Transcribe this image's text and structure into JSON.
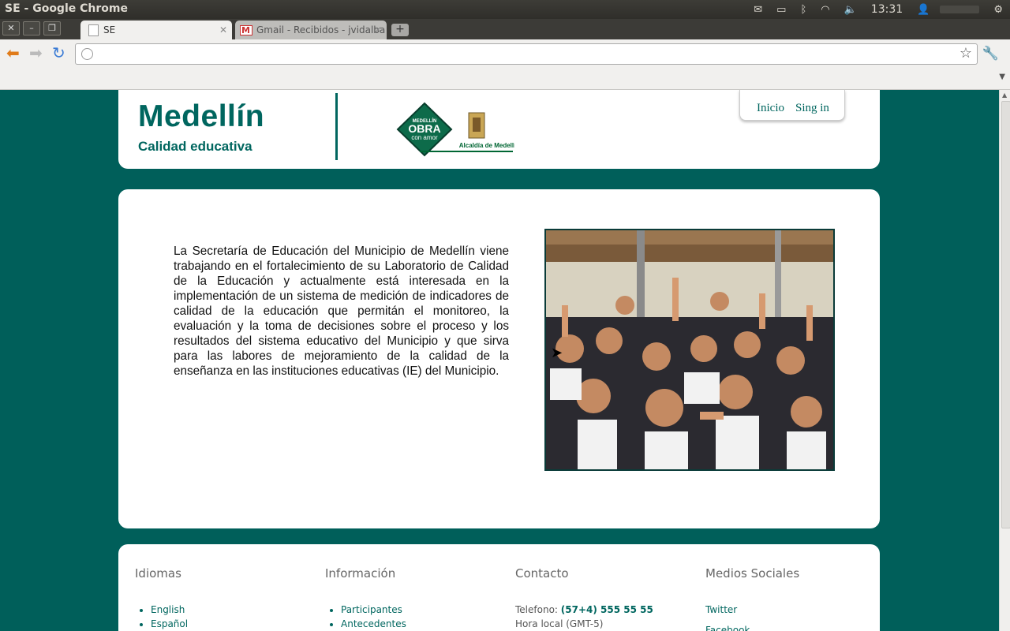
{
  "system": {
    "window_title": "SE - Google Chrome",
    "clock": "13:31"
  },
  "browser": {
    "tabs": [
      {
        "label": "SE",
        "active": true
      },
      {
        "label": "Gmail - Recibidos - jvidalba",
        "active": false
      }
    ],
    "address": ""
  },
  "header": {
    "brand_title": "Medellín",
    "brand_subtitle": "Calidad educativa",
    "logo_text": {
      "line1": "MEDELLÍN",
      "line2": "OBRA",
      "line3": "con amor",
      "caption": "Alcaldía de Medellín"
    },
    "nav": [
      {
        "label": "Inicio"
      },
      {
        "label": "Sing in"
      }
    ]
  },
  "main": {
    "intro": "La Secretaría de Educación del Municipio de Medellín viene trabajando en el fortalecimiento de su Laboratorio de Calidad de la Educación y actualmente está interesada en la implementación de un sistema de medición de indicadores de calidad de la educación que permitán el monitoreo, la evaluación y la toma de decisiones sobre el proceso y los resultados del sistema educativo del Municipio y que sirva para las labores de mejoramiento de la calidad de la enseñanza en las instituciones educativas (IE) del Municipio."
  },
  "footer": {
    "idiomas": {
      "title": "Idiomas",
      "items": [
        "English",
        "Español"
      ]
    },
    "informacion": {
      "title": "Información",
      "items": [
        "Participantes",
        "Antecedentes"
      ]
    },
    "contacto": {
      "title": "Contacto",
      "phone_label": "Telefono:",
      "phone": "(57+4) 555 55 55",
      "hora": "Hora local (GMT-5)"
    },
    "sociales": {
      "title": "Medios Sociales",
      "items": [
        "Twitter",
        "Facebook"
      ]
    }
  },
  "colors": {
    "brand": "#00665f",
    "background": "#005f5a"
  }
}
